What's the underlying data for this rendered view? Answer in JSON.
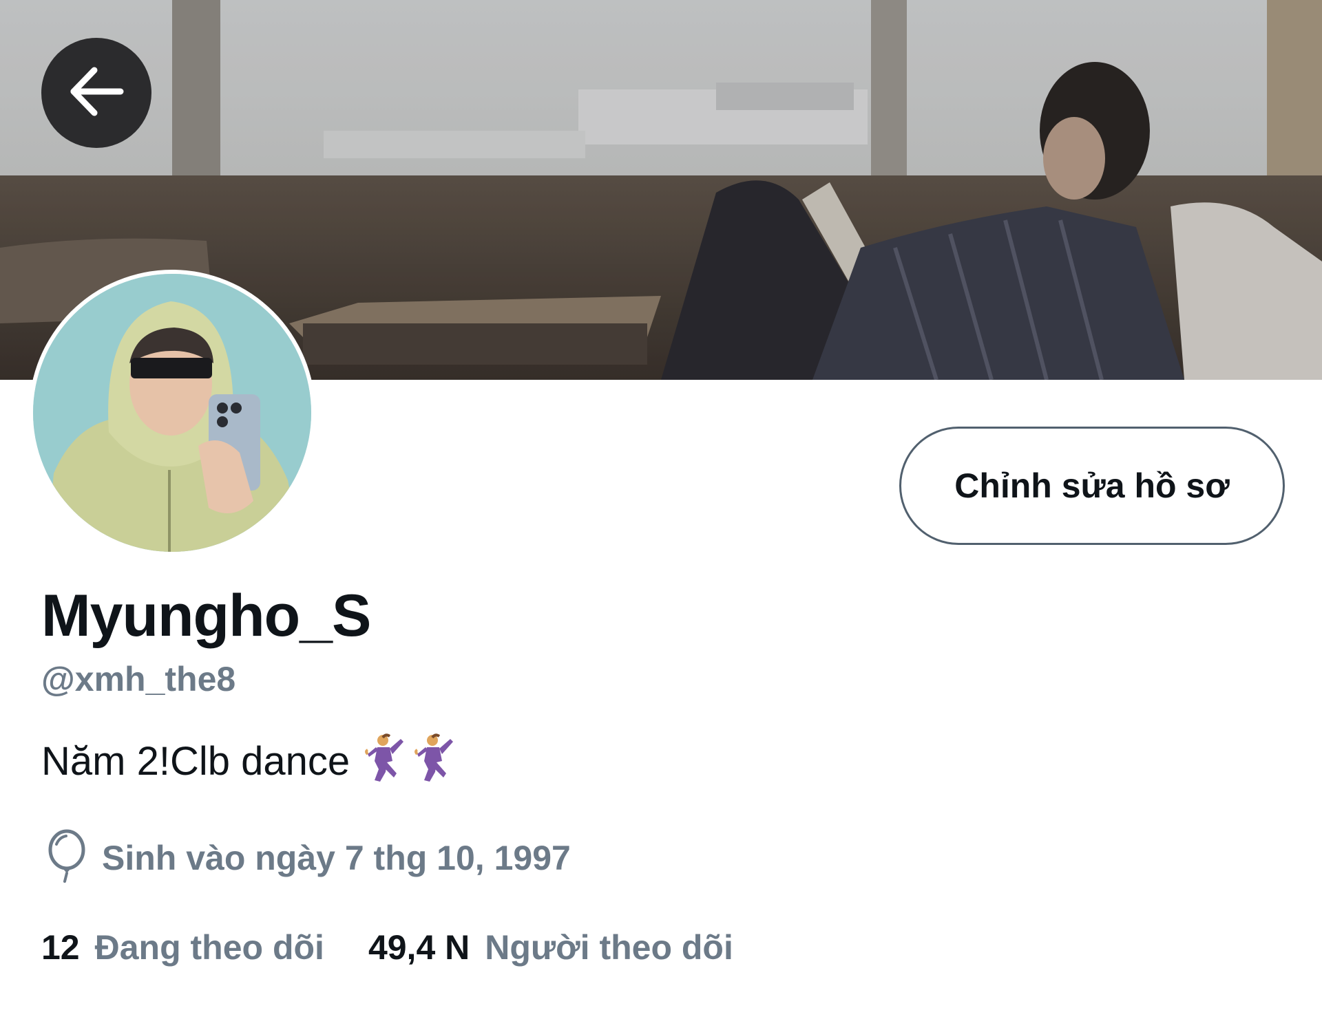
{
  "header": {
    "back_icon": "arrow-left-icon",
    "banner_image": "banner-photo"
  },
  "profile": {
    "avatar_image": "avatar-photo",
    "edit_button_label": "Chỉnh sửa hồ sơ",
    "display_name": "Myungho_S",
    "handle": "@xmh_the8",
    "bio_text": "Năm 2!Clb dance",
    "bio_emoji": [
      "man-dancing-emoji",
      "man-dancing-emoji"
    ],
    "birthday_icon": "balloon-icon",
    "birthday_text": "Sinh vào ngày 7 thg 10, 1997"
  },
  "stats": {
    "following_count": "12",
    "following_label": "Đang theo dõi",
    "followers_count": "49,4 N",
    "followers_label": "Người theo dõi"
  },
  "colors": {
    "text_primary": "#0f1419",
    "text_secondary": "#6c7a88",
    "button_border": "#51606e",
    "back_button_bg": "#2b2b2d"
  }
}
